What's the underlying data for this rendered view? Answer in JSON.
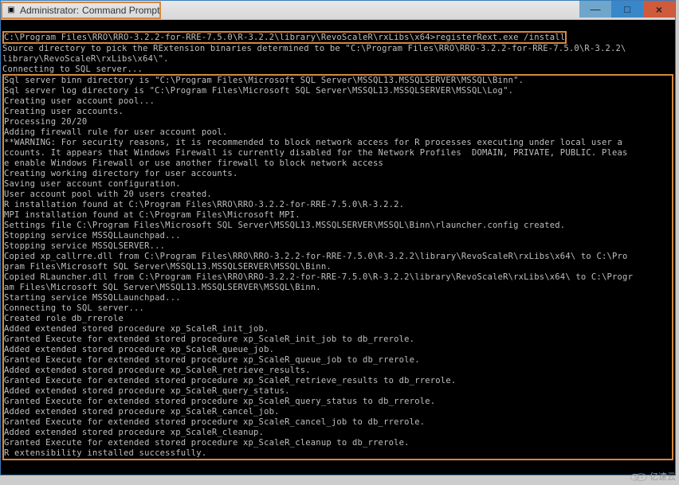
{
  "window": {
    "title_prefix": "Administrator:",
    "title_app": "Command Prompt"
  },
  "cmd_prompt_line": "C:\\Program Files\\RRO\\RRO-3.2.2-for-RRE-7.5.0\\R-3.2.2\\library\\RevoScaleR\\rxLibs\\x64>registerRext.exe /install",
  "lines_top": [
    "Source directory to pick the RExtension binaries determined to be \"C:\\Program Files\\RRO\\RRO-3.2.2-for-RRE-7.5.0\\R-3.2.2\\",
    "library\\RevoScaleR\\rxLibs\\x64\\\".",
    "Connecting to SQL server..."
  ],
  "lines_box": [
    "Sql server binn directory is \"C:\\Program Files\\Microsoft SQL Server\\MSSQL13.MSSQLSERVER\\MSSQL\\Binn\".",
    "Sql server log directory is \"C:\\Program Files\\Microsoft SQL Server\\MSSQL13.MSSQLSERVER\\MSSQL\\Log\".",
    "Creating user account pool...",
    "Creating user accounts.",
    "Processing 20/20",
    "Adding firewall rule for user account pool.",
    "**WARNING: For security reasons, it is recommended to block network access for R processes executing under local user a",
    "ccounts. It appears that Windows Firewall is currently disabled for the Network Profiles  DOMAIN, PRIVATE, PUBLIC. Pleas",
    "e enable Windows Firewall or use another firewall to block network access",
    "Creating working directory for user accounts.",
    "Saving user account configuration.",
    "User account pool with 20 users created.",
    "R installation found at C:\\Program Files\\RRO\\RRO-3.2.2-for-RRE-7.5.0\\R-3.2.2.",
    "MPI installation found at C:\\Program Files\\Microsoft MPI.",
    "Settings file C:\\Program Files\\Microsoft SQL Server\\MSSQL13.MSSQLSERVER\\MSSQL\\Binn\\rlauncher.config created.",
    "Stopping service MSSQLLaunchpad...",
    "Stopping service MSSQLSERVER...",
    "Copied xp_callrre.dll from C:\\Program Files\\RRO\\RRO-3.2.2-for-RRE-7.5.0\\R-3.2.2\\library\\RevoScaleR\\rxLibs\\x64\\ to C:\\Pro",
    "gram Files\\Microsoft SQL Server\\MSSQL13.MSSQLSERVER\\MSSQL\\Binn.",
    "Copied RLauncher.dll from C:\\Program Files\\RRO\\RRO-3.2.2-for-RRE-7.5.0\\R-3.2.2\\library\\RevoScaleR\\rxLibs\\x64\\ to C:\\Progr",
    "am Files\\Microsoft SQL Server\\MSSQL13.MSSQLSERVER\\MSSQL\\Binn.",
    "Starting service MSSQLLaunchpad...",
    "Connecting to SQL server...",
    "Created role db_rrerole",
    "Added extended stored procedure xp_ScaleR_init_job.",
    "Granted Execute for extended stored procedure xp_ScaleR_init_job to db_rrerole.",
    "Added extended stored procedure xp_ScaleR_queue_job.",
    "Granted Execute for extended stored procedure xp_ScaleR_queue_job to db_rrerole.",
    "Added extended stored procedure xp_ScaleR_retrieve_results.",
    "Granted Execute for extended stored procedure xp_ScaleR_retrieve_results to db_rrerole.",
    "Added extended stored procedure xp_ScaleR_query_status.",
    "Granted Execute for extended stored procedure xp_ScaleR_query_status to db_rrerole.",
    "Added extended stored procedure xp_ScaleR_cancel_job.",
    "Granted Execute for extended stored procedure xp_ScaleR_cancel_job to db_rrerole.",
    "Added extended stored procedure xp_ScaleR_cleanup.",
    "Granted Execute for extended stored procedure xp_ScaleR_cleanup to db_rrerole.",
    "R extensibility installed successfully."
  ],
  "watermark_text": "亿速云"
}
